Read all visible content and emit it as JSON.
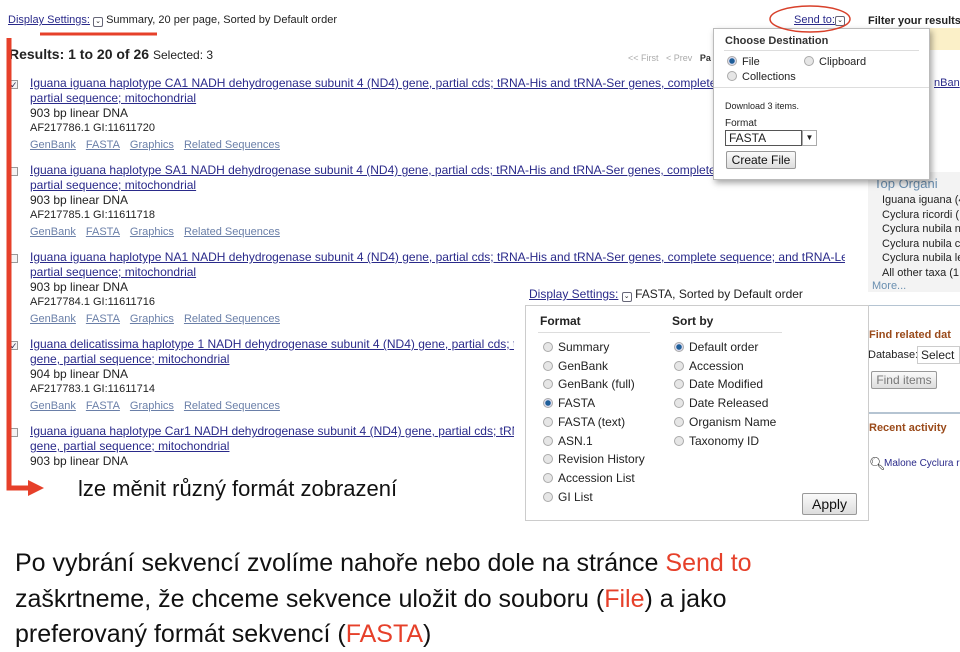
{
  "header": {
    "display_settings_label": "Display Settings:",
    "display_settings_value": "Summary, 20 per page, Sorted by Default order",
    "send_to_label": "Send to:",
    "filter_label": "Filter your results:"
  },
  "results": {
    "summary": "Results: 1 to 20 of 26",
    "selected": "Selected: 3",
    "pager": {
      "first": "<< First",
      "prev": "< Prev",
      "page": "Pa"
    }
  },
  "sublinks": [
    "GenBank",
    "FASTA",
    "Graphics",
    "Related Sequences"
  ],
  "items": [
    {
      "checked": true,
      "title1": "Iguana iguana haplotype CA1 NADH dehydrogenase subunit 4 (ND4) gene, partial cds; tRNA-His and tRNA-Ser genes, complete seque",
      "title2": "partial sequence; mitochondrial",
      "length": "903 bp linear DNA",
      "ids": "AF217786.1 GI:11611720"
    },
    {
      "checked": false,
      "title1": "Iguana iguana haplotype SA1 NADH dehydrogenase subunit 4 (ND4) gene, partial cds; tRNA-His and tRNA-Ser genes, complete seque",
      "title2": "partial sequence; mitochondrial",
      "length": "903 bp linear DNA",
      "ids": "AF217785.1 GI:11611718"
    },
    {
      "checked": false,
      "title1": "Iguana iguana haplotype NA1 NADH dehydrogenase subunit 4 (ND4) gene, partial cds; tRNA-His and tRNA-Ser genes, complete sequence; and tRNA-Leu gene,",
      "title2": "partial sequence; mitochondrial",
      "length": "903 bp linear DNA",
      "ids": "AF217784.1 GI:11611716"
    },
    {
      "checked": true,
      "title1": "Iguana delicatissima haplotype 1 NADH dehydrogenase subunit 4 (ND4) gene, partial cds; tRNA",
      "title2": "gene, partial sequence; mitochondrial",
      "length": "904 bp linear DNA",
      "ids": "AF217783.1 GI:11611714"
    },
    {
      "checked": false,
      "title1": "Iguana iguana haplotype Car1 NADH dehydrogenase subunit 4 (ND4) gene, partial cds; tRNA-H",
      "title2": "gene, partial sequence; mitochondrial",
      "length": "903 bp linear DNA",
      "ids": ""
    }
  ],
  "send_to_popup": {
    "title": "Choose Destination",
    "options": [
      {
        "label": "File",
        "selected": true
      },
      {
        "label": "Clipboard",
        "selected": false
      },
      {
        "label": "Collections",
        "selected": false
      }
    ],
    "download_text": "Download 3 items.",
    "format_label": "Format",
    "format_value": "FASTA",
    "create_button": "Create File"
  },
  "display_popup": {
    "label": "Display Settings:",
    "value": "FASTA, Sorted by Default order",
    "format_header": "Format",
    "sort_header": "Sort by",
    "formats": [
      {
        "label": "Summary",
        "selected": false
      },
      {
        "label": "GenBank",
        "selected": false
      },
      {
        "label": "GenBank (full)",
        "selected": false
      },
      {
        "label": "FASTA",
        "selected": true
      },
      {
        "label": "FASTA (text)",
        "selected": false
      },
      {
        "label": "ASN.1",
        "selected": false
      },
      {
        "label": "Revision History",
        "selected": false
      },
      {
        "label": "Accession List",
        "selected": false
      },
      {
        "label": "GI List",
        "selected": false
      }
    ],
    "sorts": [
      {
        "label": "Default order",
        "selected": true
      },
      {
        "label": "Accession",
        "selected": false
      },
      {
        "label": "Date Modified",
        "selected": false
      },
      {
        "label": "Date Released",
        "selected": false
      },
      {
        "label": "Organism Name",
        "selected": false
      },
      {
        "label": "Taxonomy ID",
        "selected": false
      }
    ],
    "apply_button": "Apply"
  },
  "sidebar": {
    "partial_link": "nBan",
    "top_organisms": "Top Organi",
    "organisms": [
      "Iguana iguana (4",
      "Cyclura ricordi (",
      "Cyclura nubila n",
      "Cyclura nubila c",
      "Cyclura nubila le",
      "All other taxa (1"
    ],
    "more": "More...",
    "find_related": "Find related dat",
    "database_label": "Database:",
    "database_value": "Select",
    "find_button": "Find items",
    "recent_activity": "Recent activity",
    "recent_item": "Malone Cyclura r"
  },
  "annotations": {
    "arrow_caption": "lze měnit různý formát zobrazení",
    "line1_a": "Po vybrání sekvencí zvolíme nahoře nebo dole na stránce ",
    "line1_red": "Send to",
    "line2_a": "zaškrtneme, že chceme sekvence uložit do souboru (",
    "line2_red": "File",
    "line2_b": ") a jako",
    "line3_a": "preferovaný formát sekvencí (",
    "line3_red": "FASTA",
    "line3_b": ")"
  },
  "colors": {
    "annotation_red": "#e6402a",
    "link": "#2a2a8a"
  }
}
